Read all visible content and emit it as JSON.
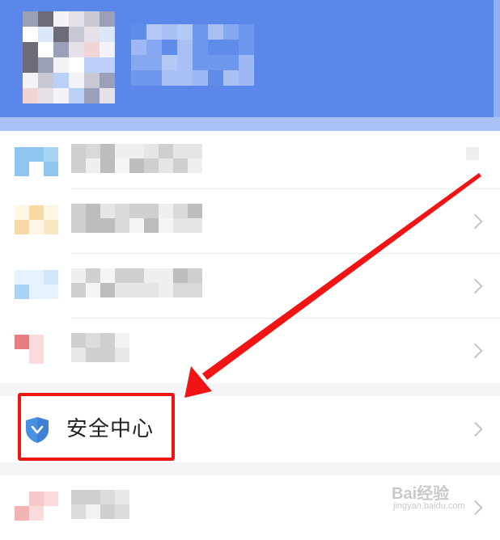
{
  "header": {
    "avatar_icon": "avatar-pixelated",
    "name_blurred": true
  },
  "menu": {
    "rows": [
      {
        "icon": "menu-item-blurred-icon",
        "label_blurred": true,
        "has_chevron": false
      },
      {
        "icon": "menu-item-blurred-icon",
        "label_blurred": true,
        "has_chevron": true
      },
      {
        "icon": "menu-item-blurred-icon",
        "label_blurred": true,
        "has_chevron": true
      },
      {
        "icon": "menu-item-blurred-icon",
        "label_blurred": true,
        "has_chevron": true
      }
    ],
    "security": {
      "icon": "shield-icon",
      "label": "安全中心",
      "has_chevron": true
    },
    "last_row": {
      "icon": "menu-item-blurred-icon",
      "label_blurred": true
    }
  },
  "annotation": {
    "color": "#f01414",
    "type": "red-arrow-and-box"
  },
  "watermark": {
    "brand": "Bai经验",
    "site": "jingyan.baidu.com"
  },
  "colors": {
    "header_blue": "#5b87ea",
    "shield_blue": "#4a90e2"
  }
}
